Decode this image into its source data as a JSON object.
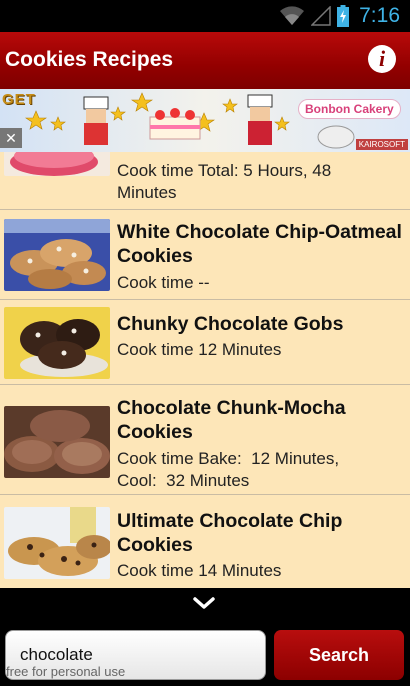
{
  "status_bar": {
    "time": "7:16",
    "icons": [
      "wifi-icon",
      "signal-icon",
      "battery-charging-icon"
    ]
  },
  "header": {
    "title": "Cookies Recipes",
    "info_label": "i"
  },
  "ad_banner": {
    "get_text": "GET",
    "brand_text": "Bonbon Cakery",
    "publisher_text": "KAIROSOFT",
    "close_label": "✕"
  },
  "recipes": [
    {
      "title": "",
      "meta": "Cook time Total: 5 Hours, 48\nMinutes",
      "thumb": "cupcake"
    },
    {
      "title": "White Chocolate Chip-Oatmeal Cookies",
      "meta": "Cook time --",
      "thumb": "oatmeal-cookies"
    },
    {
      "title": "Chunky Chocolate Gobs",
      "meta": "Cook time 12 Minutes",
      "thumb": "chocolate-gobs"
    },
    {
      "title": "Chocolate Chunk-Mocha Cookies",
      "meta": "Cook time Bake:  12 Minutes,\nCool:  32 Minutes",
      "thumb": "mocha-cookies"
    },
    {
      "title": "Ultimate Chocolate Chip Cookies",
      "meta": "Cook time 14 Minutes",
      "thumb": "chocolate-chip-cookies"
    }
  ],
  "search": {
    "value": "chocolate",
    "button_label": "Search",
    "watermark": "free for personal use"
  },
  "colors": {
    "header_red": "#a30000",
    "row_background": "#fde6b8",
    "status_time": "#3fb3e6"
  }
}
